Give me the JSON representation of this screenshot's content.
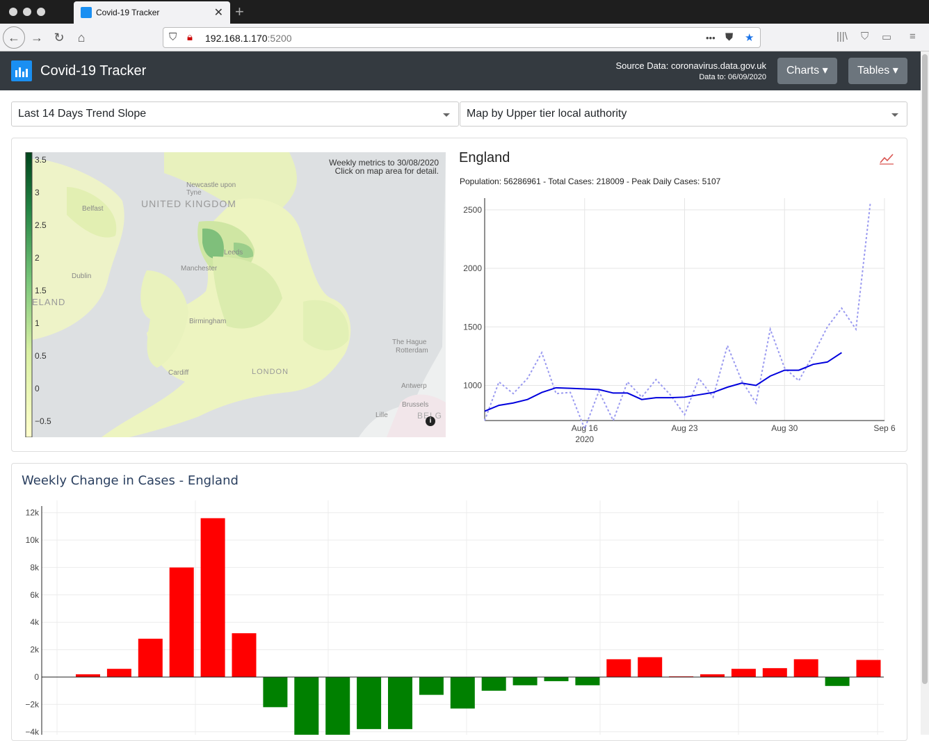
{
  "browser": {
    "tab_title": "Covid-19 Tracker",
    "url_host": "192.168.1.170",
    "url_port": ":5200",
    "url_more": "•••"
  },
  "app": {
    "title": "Covid-19 Tracker",
    "source_data": "Source Data: coronavirus.data.gov.uk",
    "data_to": "Data to: 06/09/2020",
    "charts_button": "Charts",
    "tables_button": "Tables"
  },
  "controls": {
    "metric_select": "Last 14 Days Trend Slope",
    "map_select": "Map by Upper tier local authority"
  },
  "map": {
    "note_line1": "Weekly metrics to 30/08/2020",
    "note_line2": "Click on map area for detail.",
    "colorbar_ticks": [
      "3.5",
      "3",
      "2.5",
      "2",
      "1.5",
      "1",
      "0.5",
      "0",
      "−0.5"
    ],
    "labels": {
      "united_kingdom": "UNITED KINGDOM",
      "newcastle": "Newcastle upon Tyne",
      "belfast": "Belfast",
      "dublin": "Dublin",
      "ireland": "ELAND",
      "leeds": "Leeds",
      "manchester": "Manchester",
      "birmingham": "Birmingham",
      "london": "LONDON",
      "cardiff": "Cardiff",
      "the_hague": "The Hague",
      "rotterdam": "Rotterdam",
      "antwerp": "Antwerp",
      "brussels": "Brussels",
      "lille": "Lille",
      "belg": "BELG"
    },
    "colors": {
      "low": "#f7fcb9",
      "mid": "#addd8e",
      "high": "#00441b"
    }
  },
  "england_panel": {
    "title": "England",
    "stats": "Population: 56286961 - Total Cases: 218009 - Peak Daily Cases: 5107",
    "chart_data": {
      "type": "line",
      "x_tick_labels": [
        "Aug 16\n2020",
        "Aug 23",
        "Aug 30",
        "Sep 6"
      ],
      "ylim": [
        700,
        2600
      ],
      "y_ticks": [
        1000,
        1500,
        2000,
        2500
      ],
      "x": [
        "2020-08-09",
        "2020-08-10",
        "2020-08-11",
        "2020-08-12",
        "2020-08-13",
        "2020-08-14",
        "2020-08-15",
        "2020-08-16",
        "2020-08-17",
        "2020-08-18",
        "2020-08-19",
        "2020-08-20",
        "2020-08-21",
        "2020-08-22",
        "2020-08-23",
        "2020-08-24",
        "2020-08-25",
        "2020-08-26",
        "2020-08-27",
        "2020-08-28",
        "2020-08-29",
        "2020-08-30",
        "2020-08-31",
        "2020-09-01",
        "2020-09-02",
        "2020-09-03",
        "2020-09-04",
        "2020-09-05",
        "2020-09-06"
      ],
      "series": [
        {
          "style": "dotted",
          "color": "#9a9af0",
          "values": [
            700,
            1030,
            930,
            1060,
            1280,
            930,
            940,
            630,
            950,
            700,
            1030,
            900,
            1050,
            920,
            750,
            1060,
            900,
            1340,
            1040,
            850,
            1480,
            1150,
            1040,
            1260,
            1500,
            1660,
            1480,
            2550,
            null
          ]
        },
        {
          "style": "solid",
          "color": "#0000dd",
          "values": [
            780,
            830,
            850,
            880,
            940,
            980,
            975,
            970,
            965,
            935,
            935,
            880,
            895,
            895,
            900,
            920,
            940,
            985,
            1020,
            1000,
            1080,
            1130,
            1130,
            1180,
            1200,
            1280,
            null,
            null,
            null
          ]
        }
      ]
    }
  },
  "weekly": {
    "title": "Weekly Change in Cases - England",
    "chart_data": {
      "type": "bar",
      "y_tick_labels": [
        "12k",
        "10k",
        "8k",
        "6k",
        "4k",
        "2k",
        "0",
        "−2k",
        "−4k"
      ],
      "ylim": [
        -4200,
        12200
      ],
      "positive_color": "#ff0000",
      "negative_color": "#008000",
      "values": [
        200,
        600,
        2800,
        8000,
        11600,
        3200,
        -2200,
        -4400,
        -4500,
        -3800,
        -3800,
        -1300,
        -2300,
        -1000,
        -600,
        -300,
        -600,
        1300,
        1450,
        50,
        200,
        600,
        650,
        1300,
        -650,
        1250
      ]
    }
  }
}
